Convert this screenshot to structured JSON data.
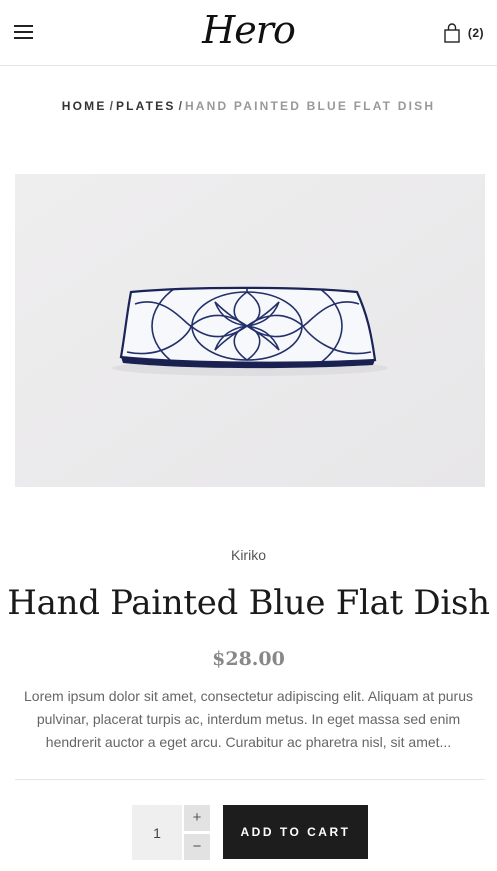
{
  "header": {
    "logo_text": "Hero",
    "cart_count": "(2)"
  },
  "breadcrumb": {
    "home": "HOME",
    "category": "PLATES",
    "current": "HAND PAINTED BLUE FLAT DISH",
    "separator": "/"
  },
  "product": {
    "vendor": "Kiriko",
    "title": "Hand Painted Blue Flat Dish",
    "price": "$28.00",
    "description": "Lorem ipsum dolor sit amet, consectetur adipiscing elit. Aliquam at purus pulvinar, placerat turpis ac, interdum metus. In eget massa sed enim hendrerit auctor a eget arcu. Curabitur ac pharetra nisl, sit amet..."
  },
  "purchase": {
    "quantity": "1",
    "plus": "+",
    "minus": "−",
    "add_to_cart": "ADD TO CART"
  },
  "icons": {
    "menu": "hamburger-menu-icon",
    "cart": "shopping-bag-icon",
    "product": "plate-image"
  },
  "colors": {
    "button_bg": "#1d1d1d",
    "price": "#888888",
    "image_bg": "#ecebec",
    "plate_pattern": "#1f2a5c"
  }
}
